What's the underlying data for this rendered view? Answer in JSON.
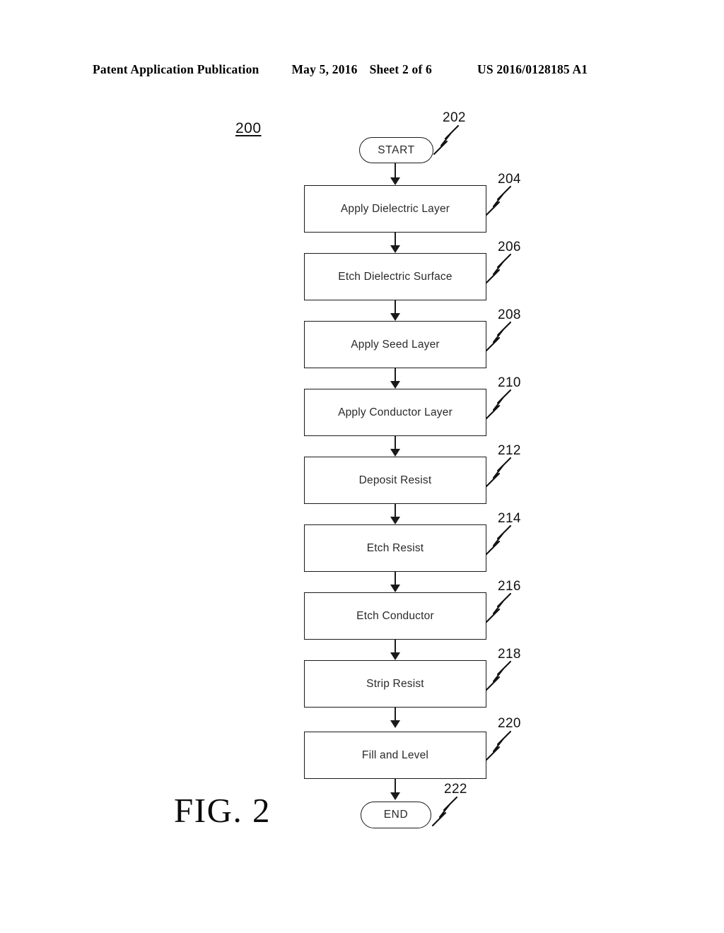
{
  "header": {
    "publication": "Patent Application Publication",
    "date": "May 5, 2016",
    "sheet": "Sheet 2 of 6",
    "patent_number": "US 2016/0128185 A1"
  },
  "figure": {
    "caption": "FIG. 2",
    "diagram_id": "200",
    "ink_color": "#1a1a1a"
  },
  "flowchart": {
    "type": "flowchart",
    "orientation": "vertical",
    "nodes": [
      {
        "ref": "202",
        "label": "START",
        "shape": "terminal"
      },
      {
        "ref": "204",
        "label": "Apply Dielectric Layer",
        "shape": "process"
      },
      {
        "ref": "206",
        "label": "Etch Dielectric Surface",
        "shape": "process"
      },
      {
        "ref": "208",
        "label": "Apply Seed Layer",
        "shape": "process"
      },
      {
        "ref": "210",
        "label": "Apply Conductor Layer",
        "shape": "process"
      },
      {
        "ref": "212",
        "label": "Deposit Resist",
        "shape": "process"
      },
      {
        "ref": "214",
        "label": "Etch Resist",
        "shape": "process"
      },
      {
        "ref": "216",
        "label": "Etch Conductor",
        "shape": "process"
      },
      {
        "ref": "218",
        "label": "Strip Resist",
        "shape": "process"
      },
      {
        "ref": "220",
        "label": "Fill and Level",
        "shape": "process"
      },
      {
        "ref": "222",
        "label": "END",
        "shape": "terminal"
      }
    ]
  }
}
